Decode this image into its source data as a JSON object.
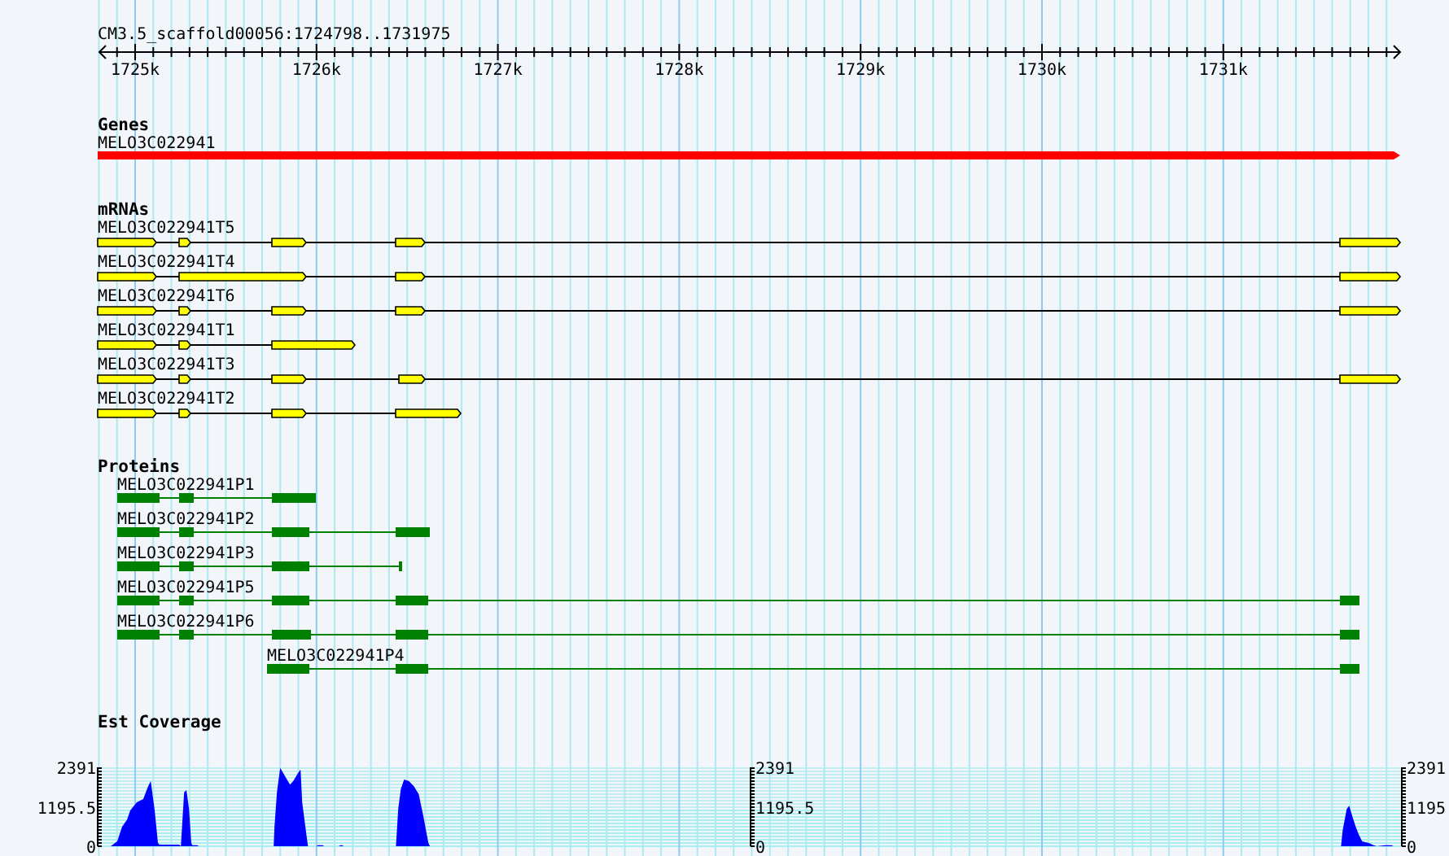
{
  "ruler": {
    "title": "CM3.5_scaffold00056:1724798..1731975",
    "labels": [
      "1725k",
      "1726k",
      "1727k",
      "1728k",
      "1729k",
      "1730k",
      "1731k"
    ]
  },
  "tracks": [
    {
      "kind": "gene",
      "title": "Genes",
      "features": [
        {
          "label": "MELO3C022941"
        }
      ]
    },
    {
      "kind": "transcript",
      "title": "mRNAs",
      "features": [
        {
          "label": "MELO3C022941T5"
        },
        {
          "label": "MELO3C022941T4"
        },
        {
          "label": "MELO3C022941T6"
        },
        {
          "label": "MELO3C022941T1"
        },
        {
          "label": "MELO3C022941T3"
        },
        {
          "label": "MELO3C022941T2"
        }
      ]
    },
    {
      "kind": "protein",
      "title": "Proteins",
      "features": [
        {
          "label": "MELO3C022941P1"
        },
        {
          "label": "MELO3C022941P2"
        },
        {
          "label": "MELO3C022941P3"
        },
        {
          "label": "MELO3C022941P5"
        },
        {
          "label": "MELO3C022941P6"
        },
        {
          "label": "MELO3C022941P4"
        }
      ]
    },
    {
      "kind": "coverage",
      "title": "Est Coverage",
      "axis_labels": [
        [
          "2391",
          "1195.5",
          "0"
        ],
        [
          "2391",
          "1195.5",
          "0"
        ],
        [
          "2391",
          "1195",
          "0"
        ]
      ]
    }
  ]
}
